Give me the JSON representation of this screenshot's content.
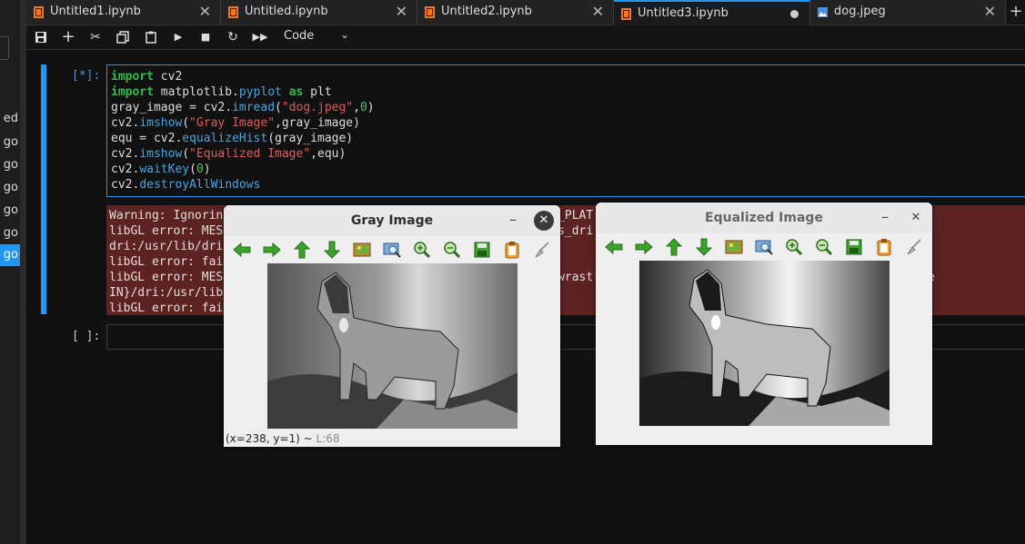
{
  "sidebar": {
    "items": [
      {
        "label": "ed",
        "active": false
      },
      {
        "label": "go",
        "active": false
      },
      {
        "label": "go",
        "active": false
      },
      {
        "label": "go",
        "active": false
      },
      {
        "label": "go",
        "active": false
      },
      {
        "label": "go",
        "active": false
      },
      {
        "label": "go",
        "active": true
      }
    ]
  },
  "tabs": [
    {
      "label": "Untitled1.ipynb",
      "icon": "notebook-icon",
      "close": "✕"
    },
    {
      "label": "Untitled.ipynb",
      "icon": "notebook-icon",
      "close": "✕"
    },
    {
      "label": "Untitled2.ipynb",
      "icon": "notebook-icon",
      "close": "✕"
    },
    {
      "label": "Untitled3.ipynb",
      "icon": "notebook-icon",
      "active": true,
      "unsaved": true
    },
    {
      "label": "dog.jpeg",
      "icon": "image-icon",
      "close": "✕"
    }
  ],
  "tab_add": "+",
  "toolbar": {
    "icons": [
      "save-icon",
      "add-cell-icon",
      "cut-icon",
      "copy-icon",
      "paste-icon",
      "run-icon",
      "stop-icon",
      "restart-icon",
      "fast-forward-icon"
    ],
    "cell_type": "Code",
    "cell_type_chevron": "⌄"
  },
  "cells": {
    "code_prompt": "[*]:",
    "code_lines": [
      {
        "parts": [
          {
            "t": "import",
            "c": "kw"
          },
          {
            "t": " cv2",
            "c": ""
          }
        ]
      },
      {
        "parts": [
          {
            "t": "import",
            "c": "kw"
          },
          {
            "t": " matplotlib.",
            "c": ""
          },
          {
            "t": "pyplot",
            "c": "fn"
          },
          {
            "t": " ",
            "c": ""
          },
          {
            "t": "as",
            "c": "kw"
          },
          {
            "t": " plt",
            "c": ""
          }
        ]
      },
      {
        "parts": [
          {
            "t": "gray_image = cv2.",
            "c": ""
          },
          {
            "t": "imread",
            "c": "fn"
          },
          {
            "t": "(",
            "c": ""
          },
          {
            "t": "\"dog.jpeg\"",
            "c": "st"
          },
          {
            "t": ",",
            "c": ""
          },
          {
            "t": "0",
            "c": "nm"
          },
          {
            "t": ")",
            "c": ""
          }
        ]
      },
      {
        "parts": [
          {
            "t": "cv2.",
            "c": ""
          },
          {
            "t": "imshow",
            "c": "fn"
          },
          {
            "t": "(",
            "c": ""
          },
          {
            "t": "\"Gray Image\"",
            "c": "st"
          },
          {
            "t": ",gray_image)",
            "c": ""
          }
        ]
      },
      {
        "parts": [
          {
            "t": "equ = cv2.",
            "c": ""
          },
          {
            "t": "equalizeHist",
            "c": "fn"
          },
          {
            "t": "(gray_image)",
            "c": ""
          }
        ]
      },
      {
        "parts": [
          {
            "t": "cv2.",
            "c": ""
          },
          {
            "t": "imshow",
            "c": "fn"
          },
          {
            "t": "(",
            "c": ""
          },
          {
            "t": "\"Equalized Image\"",
            "c": "st"
          },
          {
            "t": ",equ)",
            "c": ""
          }
        ]
      },
      {
        "parts": [
          {
            "t": "cv2.",
            "c": ""
          },
          {
            "t": "waitKey",
            "c": "fn"
          },
          {
            "t": "(",
            "c": ""
          },
          {
            "t": "0",
            "c": "nm"
          },
          {
            "t": ")",
            "c": ""
          }
        ]
      },
      {
        "parts": [
          {
            "t": "cv2.",
            "c": ""
          },
          {
            "t": "destroyAllWindows",
            "c": "fn"
          }
        ]
      }
    ],
    "output_lines": [
      "Warning: Ignorin                                               _PLAT",
      "libGL error: MES                                               s_dri                                  e or director",
      "dri:/usr/lib/dri",
      "libGL error: fai",
      "libGL error: MES                                               wrast                                  n file or dire",
      "IN}/dri:/usr/lib",
      "libGL error: fai"
    ],
    "empty_prompt": "[ ]:"
  },
  "windows": {
    "gray": {
      "title": "Gray Image",
      "minimize": "–",
      "close": "✕",
      "status_coords": "(x=238, y=1) ~ ",
      "status_value": "L:68"
    },
    "equalized": {
      "title": "Equalized Image",
      "minimize": "–",
      "close": "✕"
    },
    "toolbar_icons": [
      "pan-left-icon",
      "pan-right-icon",
      "pan-up-icon",
      "pan-down-icon",
      "zoom-fit-icon",
      "zoom-original-icon",
      "zoom-in-icon",
      "zoom-out-icon",
      "save-image-icon",
      "copy-image-icon",
      "properties-icon"
    ]
  },
  "colors": {
    "accent": "#2196f3",
    "error_bg": "#5c2322",
    "keyword": "#2fbe4d",
    "string": "#e05b5b"
  }
}
